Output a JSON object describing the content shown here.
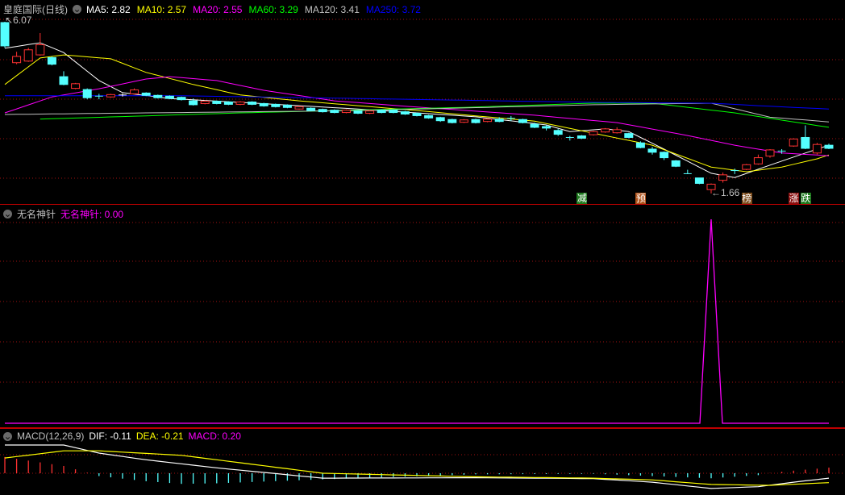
{
  "main": {
    "title": "皇庭国际(日线)",
    "ma_labels": [
      {
        "text": "MA5: 2.82",
        "color": "#ffffff"
      },
      {
        "text": "MA10: 2.57",
        "color": "#ffff00"
      },
      {
        "text": "MA20: 2.55",
        "color": "#ff00ff"
      },
      {
        "text": "MA60: 3.29",
        "color": "#00ff00"
      },
      {
        "text": "MA120: 3.41",
        "color": "#c0c0c0"
      },
      {
        "text": "MA250: 3.72",
        "color": "#0000ff"
      }
    ],
    "high_label": "6.07",
    "low_label": "1.66",
    "signals": [
      {
        "text": "减",
        "index": 49,
        "bg": "#1f7a1f"
      },
      {
        "text": "预",
        "index": 54,
        "bg": "#b0521a"
      },
      {
        "text": "榜",
        "index": 63,
        "bg": "#7a4a1a"
      },
      {
        "text": "涨",
        "index": 67,
        "bg": "#8a1010"
      },
      {
        "text": "跌",
        "index": 68,
        "bg": "#1f7a1f"
      }
    ]
  },
  "indicator": {
    "title": "无名神针",
    "value_label": "无名神针: 0.00"
  },
  "macd": {
    "title": "MACD(12,26,9)",
    "dif_label": "DIF: -0.11",
    "dea_label": "DEA: -0.21",
    "macd_label": "MACD: 0.20"
  },
  "colors": {
    "up": "#ff3232",
    "down": "#54ffff",
    "grid": "#a01010",
    "border": "#c00000"
  },
  "chart_data": {
    "type": "candlestick",
    "candles_ochl_note": "each candle [open, close, high, low]",
    "candles": [
      [
        6.05,
        5.45,
        6.07,
        5.4
      ],
      [
        5.02,
        5.18,
        5.3,
        4.98
      ],
      [
        5.06,
        5.35,
        5.4,
        5.04
      ],
      [
        5.22,
        5.48,
        5.78,
        5.2
      ],
      [
        5.15,
        4.98,
        5.18,
        4.95
      ],
      [
        4.66,
        4.46,
        4.8,
        4.44
      ],
      [
        4.36,
        4.48,
        4.5,
        4.34
      ],
      [
        4.33,
        4.12,
        4.36,
        4.08
      ],
      [
        4.16,
        4.15,
        4.22,
        4.08
      ],
      [
        4.14,
        4.2,
        4.22,
        4.12
      ],
      [
        4.19,
        4.19,
        4.23,
        4.15
      ],
      [
        4.22,
        4.32,
        4.36,
        4.2
      ],
      [
        4.24,
        4.18,
        4.26,
        4.16
      ],
      [
        4.18,
        4.12,
        4.2,
        4.1
      ],
      [
        4.16,
        4.1,
        4.18,
        4.08
      ],
      [
        4.13,
        4.07,
        4.15,
        4.05
      ],
      [
        4.04,
        3.94,
        4.1,
        3.92
      ],
      [
        3.97,
        4.03,
        4.05,
        3.95
      ],
      [
        4.03,
        3.97,
        4.05,
        3.95
      ],
      [
        4.01,
        3.95,
        4.03,
        3.93
      ],
      [
        3.95,
        4.01,
        4.03,
        3.93
      ],
      [
        4.01,
        3.95,
        4.03,
        3.93
      ],
      [
        3.97,
        3.91,
        3.99,
        3.89
      ],
      [
        3.95,
        3.89,
        3.97,
        3.87
      ],
      [
        3.93,
        3.87,
        3.95,
        3.85
      ],
      [
        3.83,
        3.89,
        3.91,
        3.81
      ],
      [
        3.85,
        3.79,
        3.87,
        3.77
      ],
      [
        3.82,
        3.76,
        3.84,
        3.74
      ],
      [
        3.8,
        3.74,
        3.82,
        3.72
      ],
      [
        3.74,
        3.8,
        3.82,
        3.72
      ],
      [
        3.78,
        3.72,
        3.8,
        3.7
      ],
      [
        3.72,
        3.78,
        3.8,
        3.7
      ],
      [
        3.8,
        3.74,
        3.82,
        3.72
      ],
      [
        3.8,
        3.74,
        3.82,
        3.72
      ],
      [
        3.76,
        3.7,
        3.78,
        3.68
      ],
      [
        3.72,
        3.66,
        3.74,
        3.64
      ],
      [
        3.66,
        3.6,
        3.68,
        3.58
      ],
      [
        3.61,
        3.53,
        3.63,
        3.5
      ],
      [
        3.56,
        3.48,
        3.58,
        3.46
      ],
      [
        3.49,
        3.55,
        3.57,
        3.47
      ],
      [
        3.56,
        3.48,
        3.58,
        3.46
      ],
      [
        3.51,
        3.57,
        3.59,
        3.49
      ],
      [
        3.57,
        3.51,
        3.62,
        3.49
      ],
      [
        3.59,
        3.58,
        3.65,
        3.52
      ],
      [
        3.56,
        3.48,
        3.58,
        3.46
      ],
      [
        3.44,
        3.36,
        3.48,
        3.34
      ],
      [
        3.38,
        3.34,
        3.42,
        3.28
      ],
      [
        3.28,
        3.18,
        3.32,
        3.14
      ],
      [
        3.1,
        3.09,
        3.14,
        3.02
      ],
      [
        3.14,
        3.08,
        3.16,
        3.06
      ],
      [
        3.17,
        3.25,
        3.27,
        3.15
      ],
      [
        3.24,
        3.32,
        3.34,
        3.22
      ],
      [
        3.22,
        3.3,
        3.36,
        3.2
      ],
      [
        3.2,
        3.1,
        3.22,
        3.08
      ],
      [
        2.96,
        2.84,
        3.0,
        2.82
      ],
      [
        2.8,
        2.72,
        2.86,
        2.66
      ],
      [
        2.72,
        2.58,
        2.74,
        2.52
      ],
      [
        2.5,
        2.36,
        2.52,
        2.34
      ],
      [
        2.17,
        2.16,
        2.27,
        2.16
      ],
      [
        2.06,
        1.92,
        2.06,
        1.9
      ],
      [
        1.76,
        1.9,
        1.92,
        1.66
      ],
      [
        2.0,
        2.14,
        2.2,
        1.94
      ],
      [
        2.25,
        2.24,
        2.3,
        2.16
      ],
      [
        2.28,
        2.4,
        2.42,
        2.26
      ],
      [
        2.42,
        2.58,
        2.66,
        2.4
      ],
      [
        2.62,
        2.78,
        2.8,
        2.58
      ],
      [
        2.75,
        2.74,
        2.8,
        2.68
      ],
      [
        2.88,
        3.06,
        3.08,
        2.86
      ],
      [
        3.1,
        2.82,
        3.41,
        2.8
      ],
      [
        2.7,
        2.92,
        2.96,
        2.66
      ],
      [
        2.9,
        2.82,
        2.94,
        2.8
      ]
    ],
    "ma_series": [
      {
        "name": "MA5",
        "color": "#ffffff",
        "points": [
          [
            0,
            5.39
          ],
          [
            3,
            5.53
          ],
          [
            5,
            5.28
          ],
          [
            8,
            4.56
          ],
          [
            10,
            4.25
          ],
          [
            14,
            4.1
          ],
          [
            20,
            4.0
          ],
          [
            30,
            3.83
          ],
          [
            40,
            3.63
          ],
          [
            46,
            3.42
          ],
          [
            48,
            3.25
          ],
          [
            51,
            3.32
          ],
          [
            53,
            3.25
          ],
          [
            56,
            2.8
          ],
          [
            60,
            2.18
          ],
          [
            62,
            2.07
          ],
          [
            65,
            2.39
          ],
          [
            68,
            2.7
          ],
          [
            70,
            2.9
          ]
        ]
      },
      {
        "name": "MA10",
        "color": "#ffff00",
        "points": [
          [
            0,
            4.46
          ],
          [
            3,
            5.14
          ],
          [
            5,
            5.22
          ],
          [
            9,
            5.12
          ],
          [
            12,
            4.77
          ],
          [
            16,
            4.46
          ],
          [
            20,
            4.19
          ],
          [
            25,
            4.04
          ],
          [
            35,
            3.79
          ],
          [
            45,
            3.52
          ],
          [
            50,
            3.21
          ],
          [
            55,
            2.9
          ],
          [
            60,
            2.34
          ],
          [
            63,
            2.22
          ],
          [
            66,
            2.34
          ],
          [
            69,
            2.55
          ],
          [
            70,
            2.65
          ]
        ]
      },
      {
        "name": "MA20",
        "color": "#ff00ff",
        "points": [
          [
            0,
            3.73
          ],
          [
            4,
            4.14
          ],
          [
            8,
            4.35
          ],
          [
            12,
            4.6
          ],
          [
            14,
            4.66
          ],
          [
            18,
            4.56
          ],
          [
            22,
            4.31
          ],
          [
            28,
            4.04
          ],
          [
            35,
            3.88
          ],
          [
            45,
            3.67
          ],
          [
            52,
            3.48
          ],
          [
            58,
            3.15
          ],
          [
            62,
            2.9
          ],
          [
            66,
            2.7
          ],
          [
            70,
            2.63
          ]
        ]
      },
      {
        "name": "MA60",
        "color": "#00ff00",
        "points": [
          [
            3,
            3.57
          ],
          [
            20,
            3.73
          ],
          [
            40,
            3.88
          ],
          [
            50,
            3.98
          ],
          [
            55,
            3.98
          ],
          [
            62,
            3.73
          ],
          [
            70,
            3.36
          ]
        ]
      },
      {
        "name": "MA120",
        "color": "#c0c0c0",
        "points": [
          [
            0,
            3.69
          ],
          [
            30,
            3.79
          ],
          [
            50,
            3.94
          ],
          [
            60,
            3.98
          ],
          [
            65,
            3.62
          ],
          [
            70,
            3.5
          ]
        ]
      },
      {
        "name": "MA250",
        "color": "#0000ff",
        "points": [
          [
            0,
            4.17
          ],
          [
            15,
            4.17
          ],
          [
            30,
            4.1
          ],
          [
            50,
            4.0
          ],
          [
            60,
            3.98
          ],
          [
            65,
            3.9
          ],
          [
            70,
            3.83
          ]
        ]
      }
    ],
    "indicator_series": {
      "name": "无名神针",
      "spike_index": 60,
      "spike_value": 100,
      "baseline": 0
    },
    "macd_dif": [
      [
        0,
        0.63
      ],
      [
        5,
        0.63
      ],
      [
        8,
        0.45
      ],
      [
        12,
        0.3
      ],
      [
        18,
        0.12
      ],
      [
        27,
        -0.11
      ],
      [
        40,
        -0.1
      ],
      [
        50,
        -0.12
      ],
      [
        55,
        -0.2
      ],
      [
        60,
        -0.34
      ],
      [
        64,
        -0.3
      ],
      [
        67,
        -0.2
      ],
      [
        70,
        -0.11
      ]
    ],
    "macd_dea": [
      [
        0,
        0.34
      ],
      [
        5,
        0.5
      ],
      [
        8,
        0.5
      ],
      [
        15,
        0.4
      ],
      [
        27,
        0.0
      ],
      [
        40,
        -0.08
      ],
      [
        50,
        -0.11
      ],
      [
        55,
        -0.15
      ],
      [
        60,
        -0.25
      ],
      [
        65,
        -0.27
      ],
      [
        70,
        -0.21
      ]
    ]
  }
}
